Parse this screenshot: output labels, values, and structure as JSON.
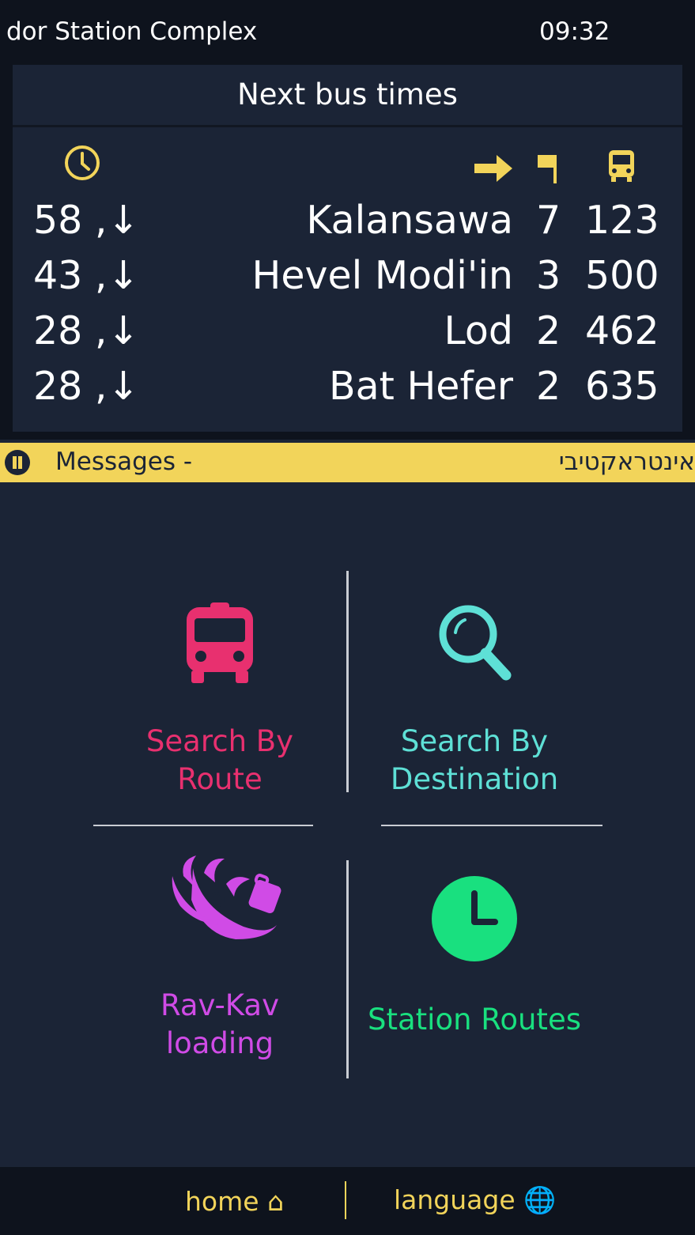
{
  "header": {
    "station_name": "Modiin Center Station Complex",
    "station_name_visible": "dor Station Complex",
    "time": "09:32"
  },
  "board": {
    "title": "Next bus times",
    "icons": [
      "clock-icon",
      "direction-arrow-icon",
      "platform-flag-icon",
      "bus-icon"
    ],
    "rows": [
      {
        "minutes": "58 ,↓",
        "destination": "Kalansawa",
        "platform": "7",
        "line": "123"
      },
      {
        "minutes": "43 ,↓",
        "destination": "Hevel Modi'in",
        "platform": "3",
        "line": "500"
      },
      {
        "minutes": "28 ,↓",
        "destination": "Lod",
        "platform": "2",
        "line": "462"
      },
      {
        "minutes": "28 ,↓",
        "destination": "Bat Hefer",
        "platform": "2",
        "line": "635"
      }
    ]
  },
  "ticker": {
    "label": "Messages -",
    "scrolling_text": "אינטראקטיבי"
  },
  "menu": {
    "search_route": {
      "line1": "Search By",
      "line2": "Route",
      "color": "#e8306f",
      "icon": "bus-icon"
    },
    "search_destination": {
      "line1": "Search By",
      "line2": "Destination",
      "color": "#5ee0d6",
      "icon": "magnifier-icon"
    },
    "ravkav": {
      "line1": "Rav-Kav",
      "line2": "loading",
      "color": "#d04be6",
      "icon": "ravkav-hand-icon"
    },
    "station_routes": {
      "line1": "Station Routes",
      "color": "#19e07f",
      "icon": "clock-icon"
    }
  },
  "footer": {
    "home": "home",
    "language": "language"
  },
  "colors": {
    "accent": "#f2d45a",
    "background": "#1b2436",
    "bar": "#0e131d"
  }
}
